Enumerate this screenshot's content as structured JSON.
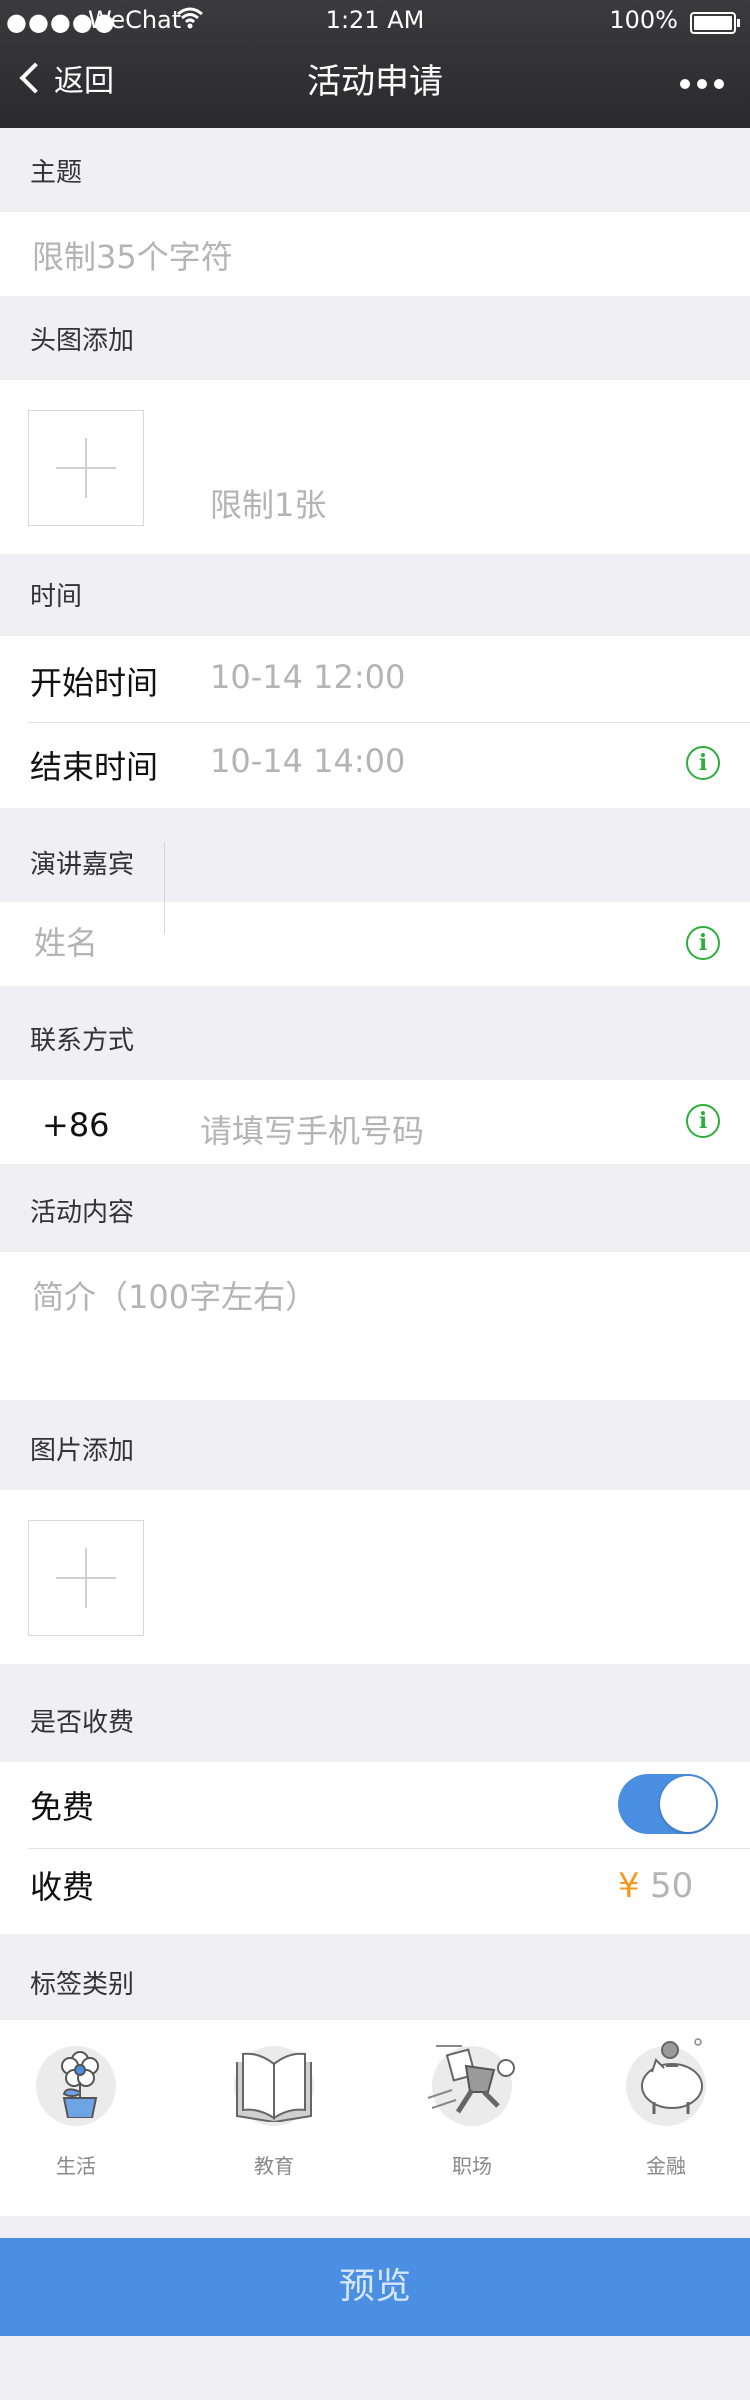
{
  "status_bar": {
    "carrier": "WeChat",
    "time": "1:21 AM",
    "battery": "100%"
  },
  "nav": {
    "back_label": "返回",
    "title": "活动申请"
  },
  "subject": {
    "label": "主题",
    "placeholder": "限制35个字符"
  },
  "header_image": {
    "label": "头图添加",
    "hint": "限制1张"
  },
  "time": {
    "label": "时间",
    "start_label": "开始时间",
    "start_value": "10-14 12:00",
    "end_label": "结束时间",
    "end_value": "10-14 14:00"
  },
  "speaker": {
    "label": "演讲嘉宾",
    "placeholder": "姓名"
  },
  "contact": {
    "label": "联系方式",
    "country_code": "+86",
    "placeholder": "请填写手机号码"
  },
  "content": {
    "label": "活动内容",
    "placeholder": "简介（100字左右）"
  },
  "images": {
    "label": "图片添加"
  },
  "fee": {
    "label": "是否收费",
    "free_label": "免费",
    "free_toggle_on": true,
    "paid_label": "收费",
    "currency": "¥",
    "price": "50"
  },
  "tags": {
    "label": "标签类别",
    "items": [
      {
        "label": "生活",
        "icon": "flower-pot-icon"
      },
      {
        "label": "教育",
        "icon": "open-book-icon"
      },
      {
        "label": "职场",
        "icon": "running-man-icon"
      },
      {
        "label": "金融",
        "icon": "piggy-bank-icon"
      }
    ]
  },
  "preview_button": "预览",
  "colors": {
    "accent": "#4a8fe1",
    "info_green": "#2dae3b",
    "price_orange": "#f39a1e",
    "background": "#efeff4"
  }
}
